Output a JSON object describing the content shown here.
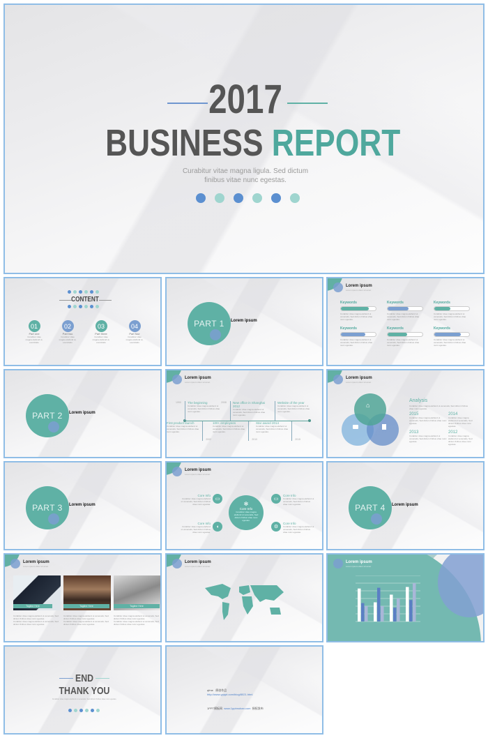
{
  "cover": {
    "year": "2017",
    "title_a": "BUSINESS",
    "title_b": "REPORT",
    "subtitle_1": "Curabitur vitae magna ligula. Sed dictum",
    "subtitle_2": "finibus vitae nunc egestas."
  },
  "colors": {
    "teal": "#4fa89d",
    "blue": "#5b8fd0",
    "light_teal": "#9fd5cf",
    "slate_blue": "#7b9fd0",
    "dark_text": "#555555",
    "border": "#8fbde6"
  },
  "content": {
    "title": "CONTENT",
    "items": [
      {
        "num": "01",
        "label": "Part one"
      },
      {
        "num": "02",
        "label": "Part two"
      },
      {
        "num": "03",
        "label": "Part three"
      },
      {
        "num": "04",
        "label": "Part four"
      }
    ],
    "desc": "Curabitur vitae magna eleifend ut, exercitatio"
  },
  "parts": [
    {
      "label": "PART 1",
      "title": "Lorem ipsum"
    },
    {
      "label": "PART 2",
      "title": "Lorem ipsum"
    },
    {
      "label": "PART 3",
      "title": "Lorem ipsum"
    },
    {
      "label": "PART 4",
      "title": "Lorem ipsum"
    }
  ],
  "header_title": "Lorem ipsum",
  "header_sub": "Lorem ipsum dolor sit amet",
  "keywords": [
    {
      "label": "Keywords",
      "value": 80
    },
    {
      "label": "Keywords",
      "value": 60
    },
    {
      "label": "Keywords",
      "value": 45
    },
    {
      "label": "Keywords",
      "value": 70
    },
    {
      "label": "Keywords",
      "value": 55
    },
    {
      "label": "Keywords",
      "value": 75
    }
  ],
  "body_text": "Curabitur vitae magna eleifend ut venenatis, Sed dictum finibus vitae nunc egestas.",
  "timeline": {
    "top": [
      {
        "year": "1990",
        "title": "The beginning"
      },
      {
        "year": "2008",
        "title": "New office in Shanghai 2012"
      },
      {
        "year": "",
        "title": "Website of the year"
      }
    ],
    "bottom": [
      {
        "year": "2002",
        "title": "First product launch"
      },
      {
        "year": "2010",
        "title": "100+ employees"
      },
      {
        "year": "2015",
        "title": "Star award 2014"
      }
    ]
  },
  "analysis": {
    "title": "Analysis",
    "years": [
      "2015",
      "2014",
      "2013",
      "2012"
    ]
  },
  "core": {
    "center": "Core Info",
    "items": [
      "Core Info",
      "Core Info",
      "Core Info",
      "Core Info"
    ]
  },
  "photos": {
    "tagline": "Tagline Here"
  },
  "chart_data": {
    "type": "bar",
    "categories": [
      "1",
      "2",
      "3",
      "4"
    ],
    "series": [
      {
        "values": [
          4.3,
          2.5,
          3.5,
          4.5
        ]
      },
      {
        "values": [
          2.4,
          4.4,
          1.8,
          2.8
        ]
      },
      {
        "values": [
          2.0,
          2.0,
          3.0,
          5.0
        ]
      }
    ],
    "ylim": [
      0,
      6
    ],
    "grid": true,
    "colors": [
      "#ffffff",
      "#5b7fc4",
      "#a9b7d8"
    ]
  },
  "end": {
    "title": "END",
    "thanks": "THANK YOU",
    "desc": "Curabitur vitae magna eleifend ut venenatis. Sed dictum finibus vitae nunc egestas."
  },
  "credits": {
    "line1_a": "qfme",
    "line1_b": "原创作品",
    "link1": "http://www.ypppt.com/blog/8021.html",
    "line2_a": "1PPT模板网",
    "link2": "www.1pptmoban.com",
    "line2_b": "授权发布"
  }
}
